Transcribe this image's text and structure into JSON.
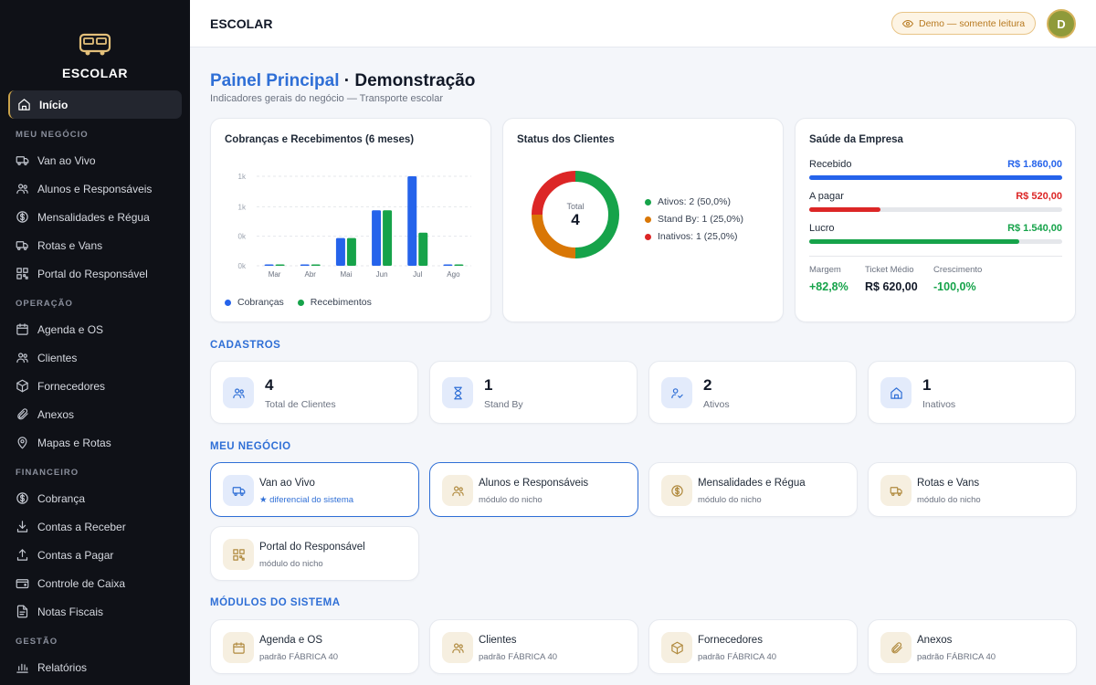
{
  "app": {
    "name": "ESCOLAR"
  },
  "sidebar": {
    "active": "Início",
    "sections": [
      {
        "title": "",
        "items": [
          {
            "label": "Início",
            "icon": "home-icon"
          }
        ]
      },
      {
        "title": "MEU NEGÓCIO",
        "items": [
          {
            "label": "Van ao Vivo",
            "icon": "van-icon"
          },
          {
            "label": "Alunos e Responsáveis",
            "icon": "users-icon"
          },
          {
            "label": "Mensalidades e Régua",
            "icon": "dollar-icon"
          },
          {
            "label": "Rotas e Vans",
            "icon": "truck-icon"
          },
          {
            "label": "Portal do Responsável",
            "icon": "qr-icon"
          }
        ]
      },
      {
        "title": "OPERAÇÃO",
        "items": [
          {
            "label": "Agenda e OS",
            "icon": "calendar-icon"
          },
          {
            "label": "Clientes",
            "icon": "users-icon"
          },
          {
            "label": "Fornecedores",
            "icon": "box-icon"
          },
          {
            "label": "Anexos",
            "icon": "paperclip-icon"
          },
          {
            "label": "Mapas e Rotas",
            "icon": "map-pin-icon"
          }
        ]
      },
      {
        "title": "FINANCEIRO",
        "items": [
          {
            "label": "Cobrança",
            "icon": "dollar-icon"
          },
          {
            "label": "Contas a Receber",
            "icon": "download-icon"
          },
          {
            "label": "Contas a Pagar",
            "icon": "upload-icon"
          },
          {
            "label": "Controle de Caixa",
            "icon": "wallet-icon"
          },
          {
            "label": "Notas Fiscais",
            "icon": "file-icon"
          }
        ]
      },
      {
        "title": "GESTÃO",
        "items": [
          {
            "label": "Relatórios",
            "icon": "bar-chart-icon"
          }
        ]
      }
    ]
  },
  "topbar": {
    "title": "ESCOLAR",
    "demo_badge": "Demo — somente leitura",
    "avatar_initial": "D"
  },
  "page": {
    "title_accent": "Painel Principal",
    "title_rest": " · Demonstração",
    "subtitle": "Indicadores gerais do negócio — Transporte escolar"
  },
  "charts": {
    "billing": {
      "title": "Cobranças e Recebimentos (6 meses)",
      "legend": [
        "Cobranças",
        "Recebimentos"
      ]
    },
    "status": {
      "title": "Status dos Clientes",
      "center_label": "Total",
      "center_value": "4",
      "legend": [
        "Ativos: 2 (50,0%)",
        "Stand By: 1 (25,0%)",
        "Inativos: 1 (25,0%)"
      ]
    }
  },
  "chart_data": [
    {
      "type": "bar",
      "title": "Cobranças e Recebimentos (6 meses)",
      "categories": [
        "Mar",
        "Abr",
        "Mai",
        "Jun",
        "Jul",
        "Ago"
      ],
      "y_tick_labels": [
        "0k",
        "0k",
        "1k",
        "1k"
      ],
      "ylim": [
        0,
        1000
      ],
      "grid": true,
      "legend_position": "bottom",
      "series": [
        {
          "name": "Cobranças",
          "color": "#2563eb",
          "values": [
            0,
            0,
            310,
            620,
            1000,
            0
          ]
        },
        {
          "name": "Recebimentos",
          "color": "#16a34a",
          "values": [
            0,
            0,
            310,
            620,
            370,
            0
          ]
        }
      ]
    },
    {
      "type": "pie",
      "title": "Status dos Clientes",
      "labels": [
        "Ativos",
        "Stand By",
        "Inativos"
      ],
      "values": [
        2,
        1,
        1
      ],
      "colors": [
        "#16a34a",
        "#d97706",
        "#dc2626"
      ],
      "legend_position": "right"
    }
  ],
  "health": {
    "title": "Saúde da Empresa",
    "rows": [
      {
        "label": "Recebido",
        "value": "R$ 1.860,00",
        "color": "#2563eb",
        "fill": 1.0
      },
      {
        "label": "A pagar",
        "value": "R$ 520,00",
        "color": "#dc2626",
        "fill": 0.28
      },
      {
        "label": "Lucro",
        "value": "R$ 1.540,00",
        "color": "#16a34a",
        "fill": 0.83
      }
    ],
    "kpis": [
      {
        "label": "Margem",
        "value": "+82,8%",
        "color": "#16a34a"
      },
      {
        "label": "Ticket Médio",
        "value": "R$ 620,00",
        "color": "#111827"
      },
      {
        "label": "Crescimento",
        "value": "-100,0%",
        "color": "#16a34a"
      }
    ]
  },
  "cadastros": {
    "title": "CADASTROS",
    "items": [
      {
        "value": "4",
        "label": "Total de Clientes",
        "icon": "users-icon"
      },
      {
        "value": "1",
        "label": "Stand By",
        "icon": "hourglass-icon"
      },
      {
        "value": "2",
        "label": "Ativos",
        "icon": "user-check-icon"
      },
      {
        "value": "1",
        "label": "Inativos",
        "icon": "home-icon"
      }
    ]
  },
  "meu_negocio": {
    "title": "MEU NEGÓCIO",
    "items": [
      {
        "title": "Van ao Vivo",
        "sub": "★ diferencial do sistema",
        "icon": "van-icon"
      },
      {
        "title": "Alunos e Responsáveis",
        "sub": "módulo do nicho",
        "icon": "users-icon"
      },
      {
        "title": "Mensalidades e Régua",
        "sub": "módulo do nicho",
        "icon": "dollar-icon"
      },
      {
        "title": "Rotas e Vans",
        "sub": "módulo do nicho",
        "icon": "truck-icon"
      },
      {
        "title": "Portal do Responsável",
        "sub": "módulo do nicho",
        "icon": "qr-icon"
      }
    ]
  },
  "modulos": {
    "title": "MÓDULOS DO SISTEMA",
    "items": [
      {
        "title": "Agenda e OS",
        "sub": "padrão FÁBRICA 40",
        "icon": "calendar-icon"
      },
      {
        "title": "Clientes",
        "sub": "padrão FÁBRICA 40",
        "icon": "users-icon"
      },
      {
        "title": "Fornecedores",
        "sub": "padrão FÁBRICA 40",
        "icon": "box-icon"
      },
      {
        "title": "Anexos",
        "sub": "padrão FÁBRICA 40",
        "icon": "paperclip-icon"
      }
    ]
  }
}
